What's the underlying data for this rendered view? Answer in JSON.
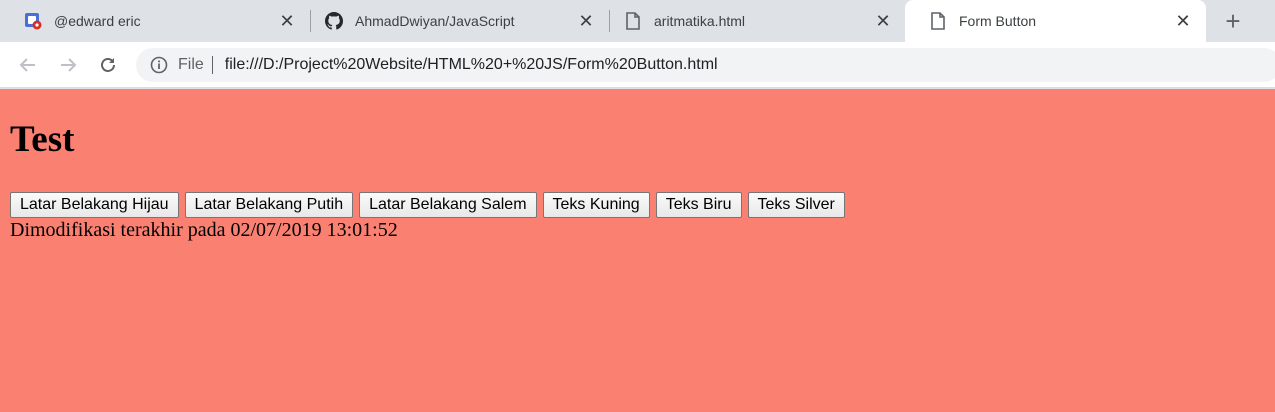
{
  "browser": {
    "tabs": [
      {
        "title": "@edward eric",
        "icon": "profile-app-icon"
      },
      {
        "title": "AhmadDwiyan/JavaScript",
        "icon": "github-icon"
      },
      {
        "title": "aritmatika.html",
        "icon": "document-icon"
      },
      {
        "title": "Form Button",
        "icon": "document-icon",
        "active": true
      }
    ],
    "new_tab_label": "+",
    "close_glyph": "✕",
    "address": {
      "scheme_label": "File",
      "url": "file:///D:/Project%20Website/HTML%20+%20JS/Form%20Button.html"
    }
  },
  "page": {
    "background": "#fa8072",
    "heading": "Test",
    "buttons": [
      "Latar Belakang Hijau",
      "Latar Belakang Putih",
      "Latar Belakang Salem",
      "Teks Kuning",
      "Teks Biru",
      "Teks Silver"
    ],
    "modified_text": "Dimodifikasi terakhir pada 02/07/2019 13:01:52"
  }
}
